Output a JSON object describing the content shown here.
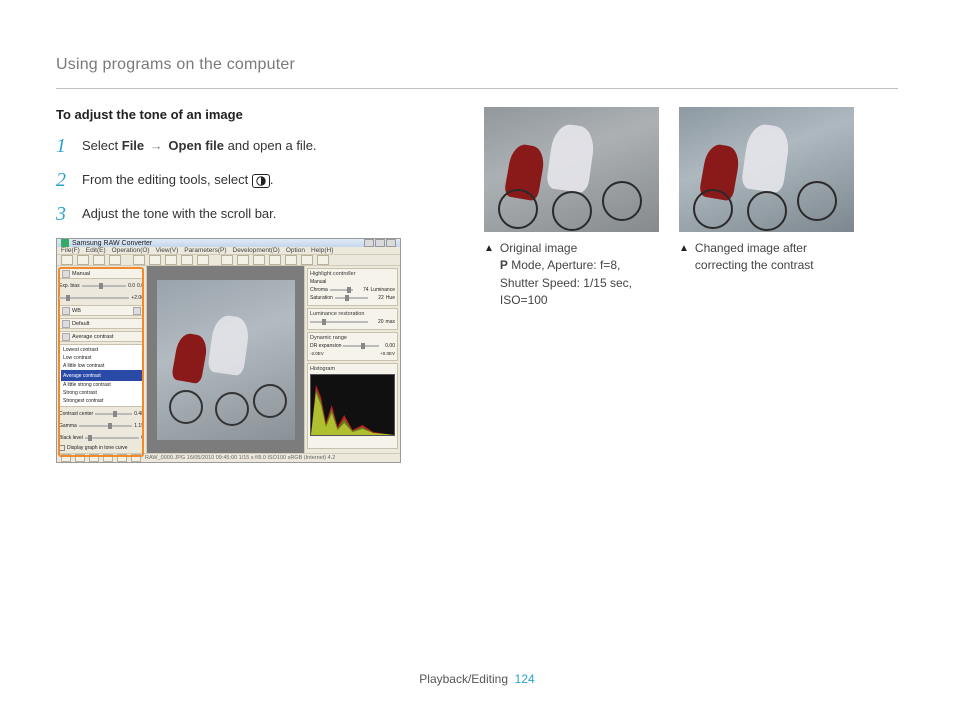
{
  "section_title": "Using programs on the computer",
  "subheading": "To adjust the tone of an image",
  "steps": [
    {
      "num": "1",
      "pre": "Select ",
      "b1": "File",
      "arrow": "→",
      "b2": "Open file",
      "post": " and open a file."
    },
    {
      "num": "2",
      "pre": "From the editing tools, select ",
      "post": "."
    },
    {
      "num": "3",
      "text": "Adjust the tone with the scroll bar."
    }
  ],
  "app": {
    "title": "Samsung RAW Converter",
    "menu": [
      "File(F)",
      "Edit(E)",
      "Operation(O)",
      "View(V)",
      "Parameters(P)",
      "Development(D)",
      "Option",
      "Help(H)"
    ],
    "left_panel": {
      "header": "Manual",
      "exp_bias_label": "Exp. bias",
      "exp_bias_value": "0.0",
      "exp_bias_inc": "0.0",
      "wb_label": "WB",
      "wb_auto": "A",
      "default_label": "Default",
      "contrast_label": "Average contrast",
      "options": [
        "Lowest contrast",
        "Low contrast",
        "A little low contrast",
        "Average contrast",
        "A little strong contrast",
        "Strong contrast",
        "Strongest contrast"
      ],
      "contrast_center_label": "Contrast center",
      "contrast_center_value": "0.48",
      "gamma_label": "Gamma",
      "gamma_value": "1.15",
      "black_level_label": "Black level",
      "black_level_value": "0",
      "checkbox": "Display graph in tone curve"
    },
    "right_panel": {
      "group1": "Highlight controller",
      "manual": "Manual",
      "chroma_label": "Chroma",
      "chroma_value": "74",
      "luminance_label": "Luminance",
      "saturation_label": "Saturation",
      "saturation_value": "22",
      "hue_label": "Hue",
      "group2": "Luminance restoration",
      "lum_value": "20",
      "group3": "Dynamic range",
      "dr_exp_label": "DR expansion",
      "dr_values": [
        "-2.0EV",
        "0",
        "0.00",
        "+0.0EV"
      ],
      "histogram": "Histogram"
    },
    "status": "RAW_0000.JPG 16/05/2010 09:45:00 1/15 s f/8.0 ISO100  sRGB (Internet) 4.2"
  },
  "captions": {
    "left": {
      "line1": "Original image",
      "line2_b": "P",
      "line2_rest": " Mode, Aperture: f=8,",
      "line3": "Shutter Speed: 1/15 sec,",
      "line4": "ISO=100"
    },
    "right": {
      "line1": "Changed image after",
      "line2": "correcting the contrast"
    }
  },
  "footer": {
    "section": "Playback/Editing",
    "page": "124"
  }
}
